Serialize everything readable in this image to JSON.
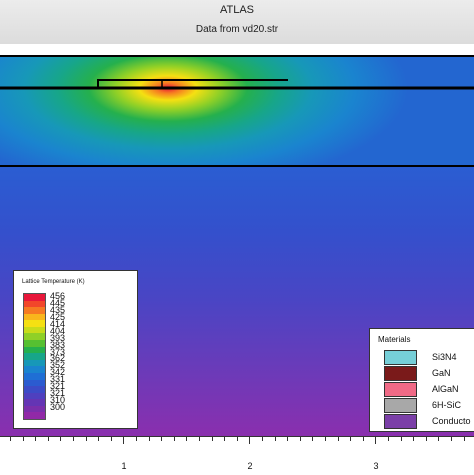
{
  "header": {
    "title": "ATLAS",
    "subtitle": "Data from vd20.str"
  },
  "legend": {
    "title": "Lattice Temperature (K)",
    "colors": [
      "#e8173a",
      "#f2462a",
      "#f67a22",
      "#f9b61c",
      "#f5e012",
      "#c8dc1a",
      "#8fd027",
      "#56c031",
      "#25b04d",
      "#17a689",
      "#1798b8",
      "#1a84cf",
      "#1f6fd5",
      "#2b5bd0",
      "#3c4bc7",
      "#4f40bf",
      "#6435b4",
      "#7a2fab",
      "#9129a7"
    ],
    "labels": [
      "456",
      "445",
      "435",
      "425",
      "414",
      "404",
      "393",
      "383",
      "373",
      "362",
      "352",
      "342",
      "331",
      "321",
      "321",
      "310",
      "300"
    ]
  },
  "materials": {
    "title": "Materials",
    "items": [
      {
        "name": "Si3N4",
        "color": "#76cfd8"
      },
      {
        "name": "GaN",
        "color": "#7a1a1a"
      },
      {
        "name": "AlGaN",
        "color": "#f06a86"
      },
      {
        "name": "6H-SiC",
        "color": "#a8a8a8"
      },
      {
        "name": "Conducto",
        "color": "#7b3fa8"
      }
    ]
  },
  "x_axis": {
    "tick_labels": [
      "1",
      "2",
      "3"
    ]
  }
}
